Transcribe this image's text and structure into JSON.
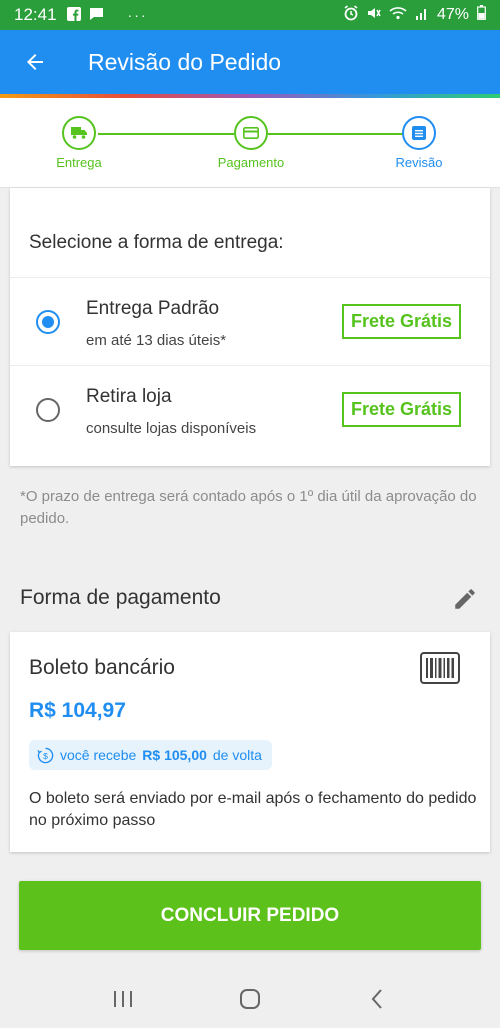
{
  "status_bar": {
    "time": "12:41",
    "dots": "···",
    "battery": "47%"
  },
  "app_bar": {
    "title": "Revisão do Pedido"
  },
  "stepper": {
    "steps": [
      {
        "label": "Entrega",
        "icon": "truck-icon"
      },
      {
        "label": "Pagamento",
        "icon": "card-icon"
      },
      {
        "label": "Revisão",
        "icon": "review-icon"
      }
    ],
    "colors": {
      "done": "#56c31e",
      "active": "#1f8ef0"
    }
  },
  "delivery": {
    "heading": "Selecione a forma de entrega:",
    "options": [
      {
        "name": "Entrega Padrão",
        "description": "em até 13 dias úteis*",
        "badge": "Frete Grátis",
        "selected": true
      },
      {
        "name": "Retira loja",
        "description": "consulte lojas disponíveis",
        "badge": "Frete Grátis",
        "selected": false
      }
    ],
    "note": "*O prazo de entrega será contado após o 1º dia útil da aprovação do pedido."
  },
  "payment": {
    "heading": "Forma de pagamento",
    "method": "Boleto bancário",
    "price": "R$ 104,97",
    "cashback_prefix": "você recebe",
    "cashback_amount": "R$ 105,00",
    "cashback_suffix": "de volta",
    "info": "O boleto será enviado por e-mail após o fechamento do pedido no próximo passo"
  },
  "actions": {
    "conclude": "CONCLUIR PEDIDO"
  },
  "colors": {
    "app_bar": "#1f8ef0",
    "status_bar": "#2a9e3a",
    "accent_green": "#5cc11a"
  }
}
